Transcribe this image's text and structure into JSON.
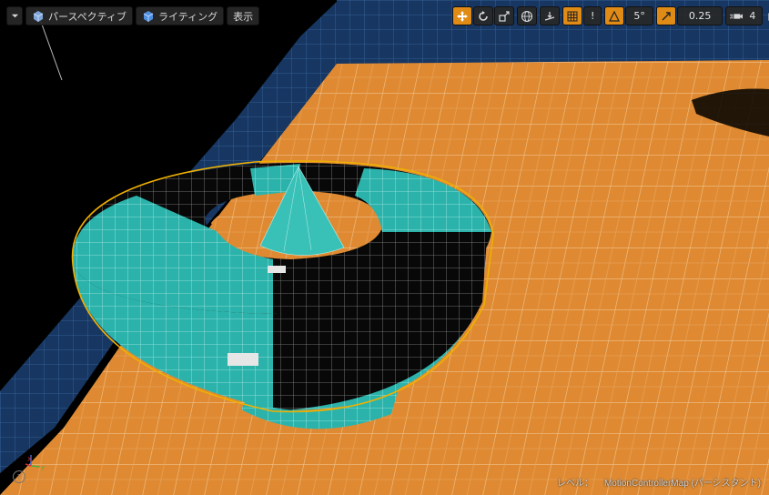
{
  "toolbar_left": {
    "menu_icon": "chevron-down-icon",
    "perspective_label": "パースペクティブ",
    "lighting_label": "ライティング",
    "show_label": "表示"
  },
  "toolbar_right": {
    "transform_tools": [
      "translate-icon",
      "rotate-icon",
      "scale-icon",
      "world-icon",
      "surface-snap-icon"
    ],
    "grid_snap_icon": "grid-icon",
    "grid_snap_value": "!",
    "rotation_snap_icon": "angle-icon",
    "rotation_snap_value": "5°",
    "scale_snap_icon": "scale-snap-icon",
    "scale_snap_value": "0.25",
    "camera_speed_icon": "camera-speed-icon",
    "camera_speed_value": "4",
    "maximize_icon": "maximize-icon"
  },
  "status": {
    "level_label": "レベル：",
    "level_name": "MotionControllerMap (パーシスタント)"
  },
  "colors": {
    "floor": "#e08a30",
    "grid_line": "#f3c58f",
    "wall": "#1c3f6c",
    "mesh_teal": "#2ab5ad",
    "mesh_dark": "#0a0a0a",
    "selection": "#f0b000",
    "toolbar_active": "#e08b16"
  }
}
